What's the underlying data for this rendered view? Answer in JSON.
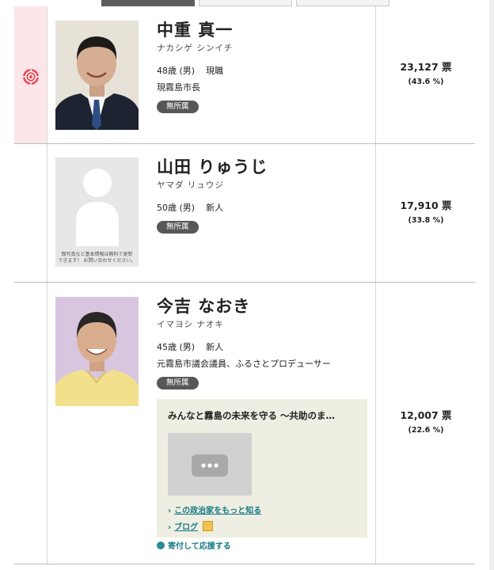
{
  "candidates": [
    {
      "name": "中重 真一",
      "kana": "ナカシゲ シンイチ",
      "age_gender": "48歳 (男)",
      "status": "現職",
      "career": "現霧島市長",
      "party": "無所属",
      "votes": "23,127 票",
      "pct": "(43.6 %)",
      "elected": true
    },
    {
      "name": "山田 りゅうじ",
      "kana": "ヤマダ リュウジ",
      "age_gender": "50歳 (男)",
      "status": "新人",
      "party": "無所属",
      "votes": "17,910 票",
      "pct": "(33.8 %)",
      "photo_note_1": "顔写真など基本情報は無料で更新",
      "photo_note_2": "できます！ お問い合わせください。"
    },
    {
      "name": "今吉 なおき",
      "kana": "イマヨシ ナオキ",
      "age_gender": "45歳 (男)",
      "status": "新人",
      "career": "元霧島市議会議員、ふるさとプロデューサー",
      "party": "無所属",
      "votes": "12,007 票",
      "pct": "(22.6 %)",
      "promo_title": "みんなと霧島の未来を守る ～共助のま…",
      "link_more": "この政治家をもっと知る",
      "link_blog": "ブログ",
      "donate": "寄付して応援する"
    }
  ],
  "colors": {
    "winner_bg": "#fde6ea",
    "winner_rose": "#e8505b",
    "badge": "#575757",
    "link": "#187a87",
    "promo_bg": "#eeeee2"
  },
  "icons": {
    "winner": "rose-icon",
    "video": "video-play-icon",
    "blog": "blog-icon",
    "donate": "donate-icon"
  }
}
